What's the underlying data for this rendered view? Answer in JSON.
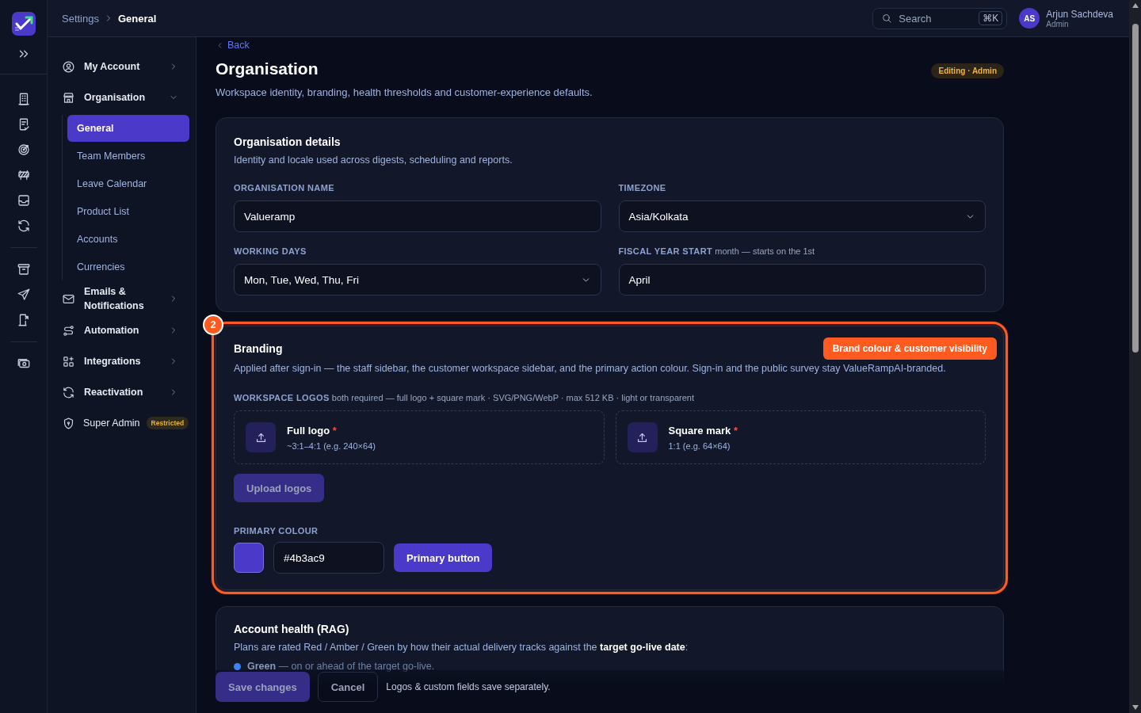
{
  "topbar": {
    "breadcrumb": [
      {
        "label": "Settings",
        "current": false
      },
      {
        "label": "General",
        "current": true
      }
    ],
    "search": {
      "placeholder": "Search",
      "shortcut": "⌘K"
    },
    "user": {
      "initials": "AS",
      "name": "Arjun Sachdeva",
      "role": "Admin"
    }
  },
  "settings_nav": [
    {
      "label": "My Account",
      "expanded": false
    },
    {
      "label": "Organisation",
      "expanded": true,
      "children": [
        {
          "label": "General",
          "selected": true
        },
        {
          "label": "Team Members",
          "selected": false
        },
        {
          "label": "Leave Calendar",
          "selected": false
        },
        {
          "label": "Product List",
          "selected": false
        },
        {
          "label": "Accounts",
          "selected": false
        },
        {
          "label": "Currencies",
          "selected": false
        }
      ]
    },
    {
      "label": "Emails & Notifications",
      "expanded": false
    },
    {
      "label": "Automation",
      "expanded": false
    },
    {
      "label": "Integrations",
      "expanded": false
    },
    {
      "label": "Reactivation",
      "expanded": false
    },
    {
      "label": "Super Admin",
      "badge": "Restricted"
    }
  ],
  "page": {
    "back": "Back",
    "title": "Organisation",
    "subtitle": "Workspace identity, branding, health thresholds and customer-experience defaults.",
    "badge": "Editing · Admin"
  },
  "org_details": {
    "title": "Organisation details",
    "description": "Identity and locale used across digests, scheduling and reports.",
    "fields": [
      {
        "label": "ORGANISATION NAME",
        "kind": "text",
        "value": "Valueramp"
      },
      {
        "label": "TIMEZONE",
        "kind": "select",
        "value": "Asia/Kolkata"
      },
      {
        "label": "WORKING DAYS",
        "kind": "select",
        "value": "Mon, Tue, Wed, Thu, Fri"
      },
      {
        "label": "FISCAL YEAR START",
        "hint": "month — starts on the 1st",
        "kind": "text",
        "value": "April"
      }
    ]
  },
  "branding": {
    "step": "2",
    "highlighted": true,
    "title": "Branding",
    "badge": "Brand colour & customer visibility",
    "description": "Applied after sign-in — the staff sidebar, the customer workspace sidebar, and the primary action colour. Sign-in and the public survey stay ValueRampAI-branded.",
    "logos_label": "WORKSPACE LOGOS",
    "logos_hint": "both required — full logo + square mark · SVG/PNG/WebP · max 512 KB · light or transparent",
    "uploads": [
      {
        "title": "Full logo",
        "required_mark": "*",
        "hint": "~3:1–4:1 (e.g. 240×64)"
      },
      {
        "title": "Square mark",
        "required_mark": "*",
        "hint": "1:1 (e.g. 64×64)"
      }
    ],
    "upload_button": {
      "label": "Upload logos",
      "disabled": true
    },
    "colour_label": "PRIMARY COLOUR",
    "colour_value": "#4b3ac9",
    "preview_button": "Primary button"
  },
  "account_health": {
    "title": "Account health (RAG)",
    "description": "Plans are rated Red / Amber / Green by how their actual delivery tracks against the **target go-live date**:",
    "levels": [
      {
        "name": "Green",
        "text": "— on or ahead of the target go-live.",
        "color": "#3b82f6"
      }
    ]
  },
  "footer": {
    "save": {
      "label": "Save changes",
      "disabled": true
    },
    "cancel": "Cancel",
    "note": "Logos & custom fields save separately."
  }
}
